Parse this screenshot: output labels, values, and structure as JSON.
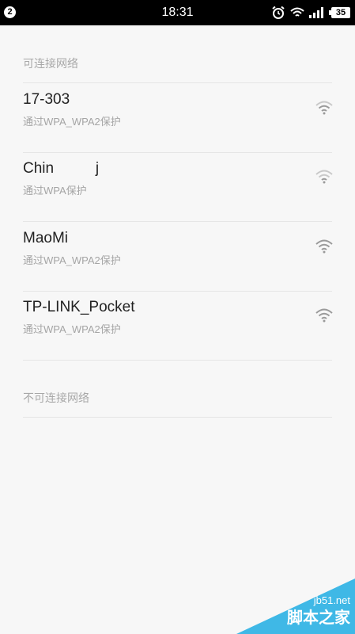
{
  "status_bar": {
    "notification_count": "2",
    "time": "18:31",
    "battery": "35",
    "icons": [
      "alarm-icon",
      "wifi-icon",
      "signal-icon",
      "battery-icon"
    ]
  },
  "sections": {
    "available_header": "可连接网络",
    "unavailable_header": "不可连接网络"
  },
  "networks": [
    {
      "name": "17-303",
      "security": "通过WPA_WPA2保护"
    },
    {
      "name": "Chin          j",
      "security": "通过WPA保护"
    },
    {
      "name": "MaoMi",
      "security": "通过WPA_WPA2保护"
    },
    {
      "name": "TP-LINK_Pocket",
      "security": "通过WPA_WPA2保护"
    }
  ],
  "watermark": {
    "site": "jb51.net",
    "brand": "脚本之家"
  },
  "colors": {
    "status_bar_bg": "#000000",
    "page_bg": "#f7f7f7",
    "watermark_blue": "#3fb8e6"
  }
}
